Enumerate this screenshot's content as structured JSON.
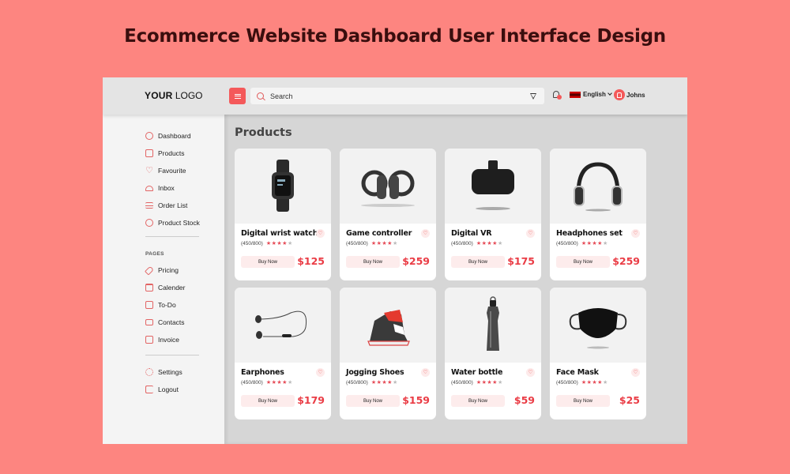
{
  "headline": "Ecommerce Website Dashboard User Interface Design",
  "topbar": {
    "logo_bold": "YOUR",
    "logo_light": "LOGO",
    "search_placeholder": "Search",
    "language": "English",
    "user_name": "Johns",
    "notification_icon": "bell-icon",
    "accent_color": "#f4595a"
  },
  "sidebar": {
    "main_items": [
      {
        "label": "Dashboard",
        "icon": "speedometer-icon"
      },
      {
        "label": "Products",
        "icon": "box-icon"
      },
      {
        "label": "Favourite",
        "icon": "heart-icon"
      },
      {
        "label": "Inbox",
        "icon": "inbox-icon"
      },
      {
        "label": "Order List",
        "icon": "list-icon"
      },
      {
        "label": "Product Stock",
        "icon": "package-icon"
      }
    ],
    "pages_label": "PAGES",
    "page_items": [
      {
        "label": "Pricing",
        "icon": "tag-icon"
      },
      {
        "label": "Calender",
        "icon": "calendar-icon"
      },
      {
        "label": "To-Do",
        "icon": "clipboard-icon"
      },
      {
        "label": "Contacts",
        "icon": "contacts-icon"
      },
      {
        "label": "Invoice",
        "icon": "invoice-icon"
      }
    ],
    "bottom_items": [
      {
        "label": "Settings",
        "icon": "gear-icon"
      },
      {
        "label": "Logout",
        "icon": "logout-icon"
      }
    ]
  },
  "main": {
    "title": "Products",
    "buy_label": "Buy Now",
    "products": [
      {
        "name": "Digital wrist watch",
        "rating_text": "(450/800)",
        "stars": 4,
        "price": "$125",
        "image": "smartwatch"
      },
      {
        "name": "Game controller",
        "rating_text": "(450/800)",
        "stars": 4,
        "price": "$259",
        "image": "vr-controllers"
      },
      {
        "name": "Digital VR",
        "rating_text": "(450/800)",
        "stars": 4,
        "price": "$175",
        "image": "vr-headset"
      },
      {
        "name": "Headphones set",
        "rating_text": "(450/800)",
        "stars": 4,
        "price": "$259",
        "image": "headphones"
      },
      {
        "name": "Earphones",
        "rating_text": "(450/800)",
        "stars": 4,
        "price": "$179",
        "image": "earphones"
      },
      {
        "name": "Jogging Shoes",
        "rating_text": "(450/800)",
        "stars": 4,
        "price": "$159",
        "image": "sneaker"
      },
      {
        "name": "Water bottle",
        "rating_text": "(450/800)",
        "stars": 4,
        "price": "$59",
        "image": "water-bottle"
      },
      {
        "name": "Face Mask",
        "rating_text": "(450/800)",
        "stars": 4,
        "price": "$25",
        "image": "face-mask"
      }
    ]
  }
}
